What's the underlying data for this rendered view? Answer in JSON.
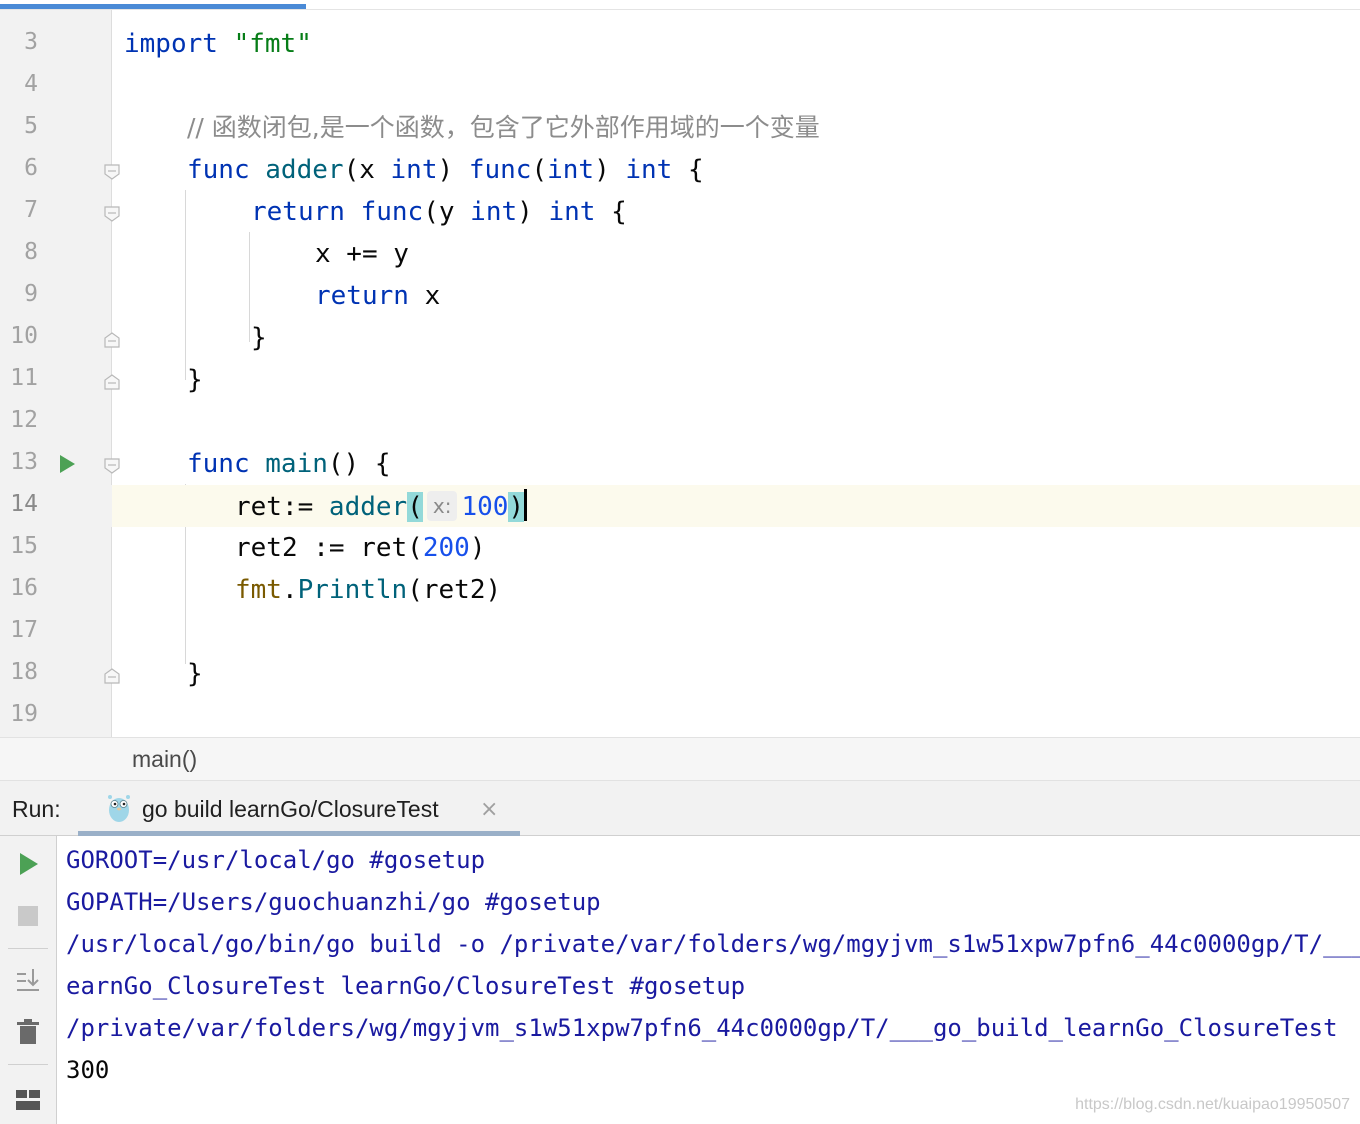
{
  "editor": {
    "line_numbers": [
      "3",
      "4",
      "5",
      "6",
      "7",
      "8",
      "9",
      "10",
      "11",
      "12",
      "13",
      "14",
      "15",
      "16",
      "17",
      "18",
      "19"
    ],
    "lines": {
      "l3": {
        "kw": "import",
        "str": "\"fmt\""
      },
      "l5": {
        "comment": "// 函数闭包,是一个函数，包含了它外部作用域的一个变量"
      },
      "l6": {
        "func": "func",
        "name": "adder",
        "p_open": "(x ",
        "int1": "int",
        "p_close": ") ",
        "func2": "func",
        "p2_open": "(",
        "int2": "int",
        "p2_close": ") ",
        "int3": "int",
        "brace": " {"
      },
      "l7": {
        "ret": "return",
        "func": "func",
        "p_open": "(y ",
        "int1": "int",
        "p_close": ") ",
        "int2": "int",
        "brace": " {"
      },
      "l8": {
        "text": "x += y"
      },
      "l9": {
        "ret": "return",
        "var": " x"
      },
      "l10": {
        "brace": "}"
      },
      "l11": {
        "brace": "}"
      },
      "l13": {
        "func": "func",
        "name": "main",
        "rest": "() {"
      },
      "l14": {
        "lhs": "ret:= ",
        "name": "adder",
        "p_open": "(",
        "hint": "x:",
        "num": "100",
        "p_close": ")"
      },
      "l15": {
        "lhs": "ret2 := ret(",
        "num": "200",
        "p_close": ")"
      },
      "l16": {
        "pkg": "fmt",
        "dot": ".",
        "fn": "Println",
        "args": "(ret2)"
      },
      "l18": {
        "brace": "}"
      }
    }
  },
  "breadcrumb": {
    "label": "main()"
  },
  "run_panel": {
    "label": "Run:",
    "tab_label": "go build learnGo/ClosureTest",
    "tab_close": "×",
    "console_lines": [
      "GOROOT=/usr/local/go #gosetup",
      "GOPATH=/Users/guochuanzhi/go #gosetup",
      "/usr/local/go/bin/go build -o /private/var/folders/wg/mgyjvm_s1w51xpw7pfn6_44c0000gp/T/___go_build_l",
      "earnGo_ClosureTest learnGo/ClosureTest #gosetup",
      "/private/var/folders/wg/mgyjvm_s1w51xpw7pfn6_44c0000gp/T/___go_build_learnGo_ClosureTest",
      "300"
    ],
    "toolbar_icons": [
      "rerun-icon",
      "stop-icon",
      "scroll-to-end-icon",
      "trash-icon",
      "layout-icon"
    ]
  },
  "watermark": "https://blog.csdn.net/kuaipao19950507",
  "colors": {
    "keyword": "#0033b3",
    "string": "#067d17",
    "comment": "#8c8c8c",
    "function": "#00627a",
    "number": "#1750eb",
    "package": "#7a5a00",
    "console_system": "#1a1aa0",
    "run_green": "#4ca155",
    "current_line": "#fcfaed"
  }
}
